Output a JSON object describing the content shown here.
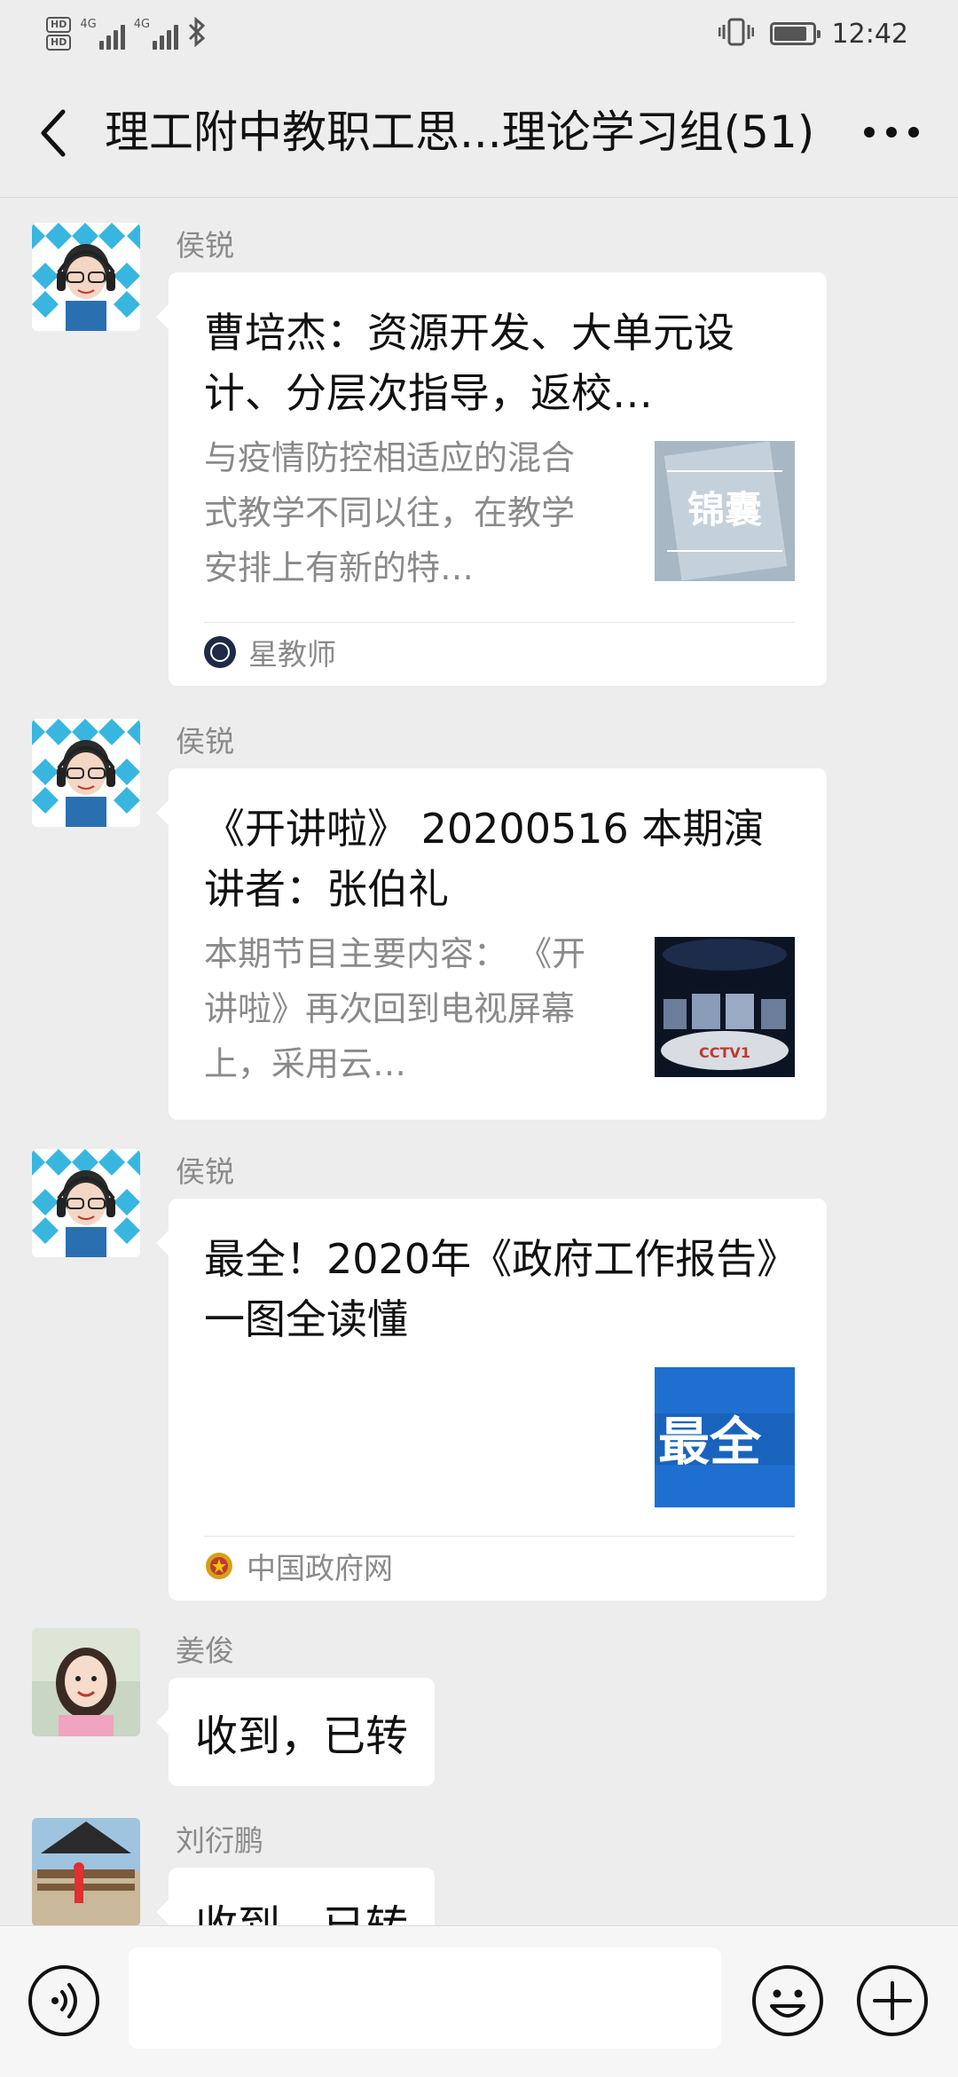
{
  "status_bar": {
    "hd1": "HD",
    "hd2": "HD",
    "net1": "4G",
    "net2": "4G",
    "time": "12:42"
  },
  "header": {
    "title": "理工附中教职工思...理论学习组(51)"
  },
  "messages": [
    {
      "sender": "侯锐",
      "type": "article",
      "title": "曹培杰：资源开发、大单元设计、分层次指导，返校…",
      "description": "与疫情防控相适应的混合式教学不同以往，在教学安排上有新的特…",
      "thumb_text": "锦囊",
      "source": "星教师"
    },
    {
      "sender": "侯锐",
      "type": "article",
      "title": "《开讲啦》 20200516 本期演讲者：张伯礼",
      "description": "本期节目主要内容： 《开讲啦》再次回到电视屏幕上，采用云…",
      "thumb_text": "CCTV1"
    },
    {
      "sender": "侯锐",
      "type": "article",
      "title": "最全！2020年《政府工作报告》一图全读懂",
      "thumb_text": "最全",
      "source": "中国政府网"
    },
    {
      "sender": "姜俊",
      "type": "text",
      "text": "收到，已转"
    },
    {
      "sender": "刘衍鹏",
      "type": "text",
      "text": "收到，已转"
    }
  ],
  "input_bar": {
    "placeholder": ""
  },
  "colors": {
    "background": "#ededed",
    "bubble": "#ffffff",
    "secondary_text": "#8a8a8a",
    "thumb_blue": "#1e6fd0"
  }
}
